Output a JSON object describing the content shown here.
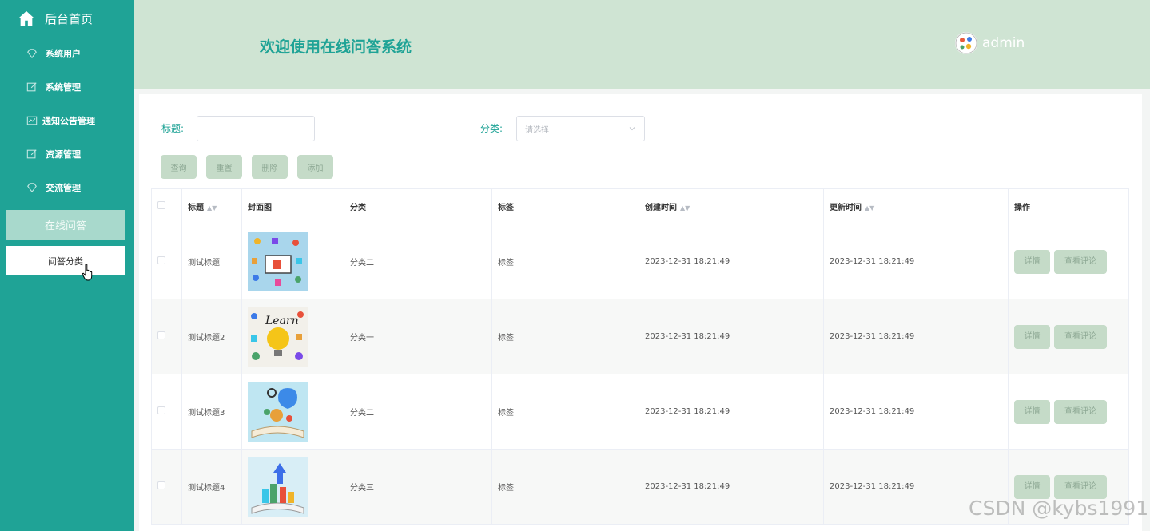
{
  "sidebar": {
    "home_label": "后台首页",
    "items": [
      {
        "label": "系统用户",
        "icon": "diamond-icon"
      },
      {
        "label": "系统管理",
        "icon": "edit-icon"
      },
      {
        "label": "通知公告管理",
        "icon": "chart-icon"
      },
      {
        "label": "资源管理",
        "icon": "edit-icon"
      },
      {
        "label": "交流管理",
        "icon": "diamond-icon"
      }
    ],
    "active_group": "在线问答",
    "active_sub": "问答分类"
  },
  "header": {
    "title": "欢迎使用在线问答系统",
    "username": "admin"
  },
  "filters": {
    "title_label": "标题:",
    "title_value": "",
    "category_label": "分类:",
    "category_placeholder": "请选择"
  },
  "buttons": {
    "query": "查询",
    "reset": "重置",
    "delete": "删除",
    "add": "添加"
  },
  "table": {
    "headers": {
      "title": "标题",
      "cover": "封面图",
      "category": "分类",
      "tag": "标签",
      "created": "创建时间",
      "updated": "更新时间",
      "actions": "操作"
    },
    "rows": [
      {
        "title": "测试标题",
        "category": "分类二",
        "tag": "标签",
        "created": "2023-12-31 18:21:49",
        "updated": "2023-12-31 18:21:49",
        "detail": "详情",
        "comments": "查看评论"
      },
      {
        "title": "测试标题2",
        "category": "分类一",
        "tag": "标签",
        "created": "2023-12-31 18:21:49",
        "updated": "2023-12-31 18:21:49",
        "detail": "详情",
        "comments": "查看评论"
      },
      {
        "title": "测试标题3",
        "category": "分类二",
        "tag": "标签",
        "created": "2023-12-31 18:21:49",
        "updated": "2023-12-31 18:21:49",
        "detail": "详情",
        "comments": "查看评论"
      },
      {
        "title": "测试标题4",
        "category": "分类三",
        "tag": "标签",
        "created": "2023-12-31 18:21:49",
        "updated": "2023-12-31 18:21:49",
        "detail": "详情",
        "comments": "查看评论"
      }
    ]
  },
  "watermark": "CSDN @kybs1991",
  "colors": {
    "sidebar": "#1fa396",
    "header": "#cfe4d3",
    "accent": "#1fa396",
    "button": "#c5dbc8"
  }
}
